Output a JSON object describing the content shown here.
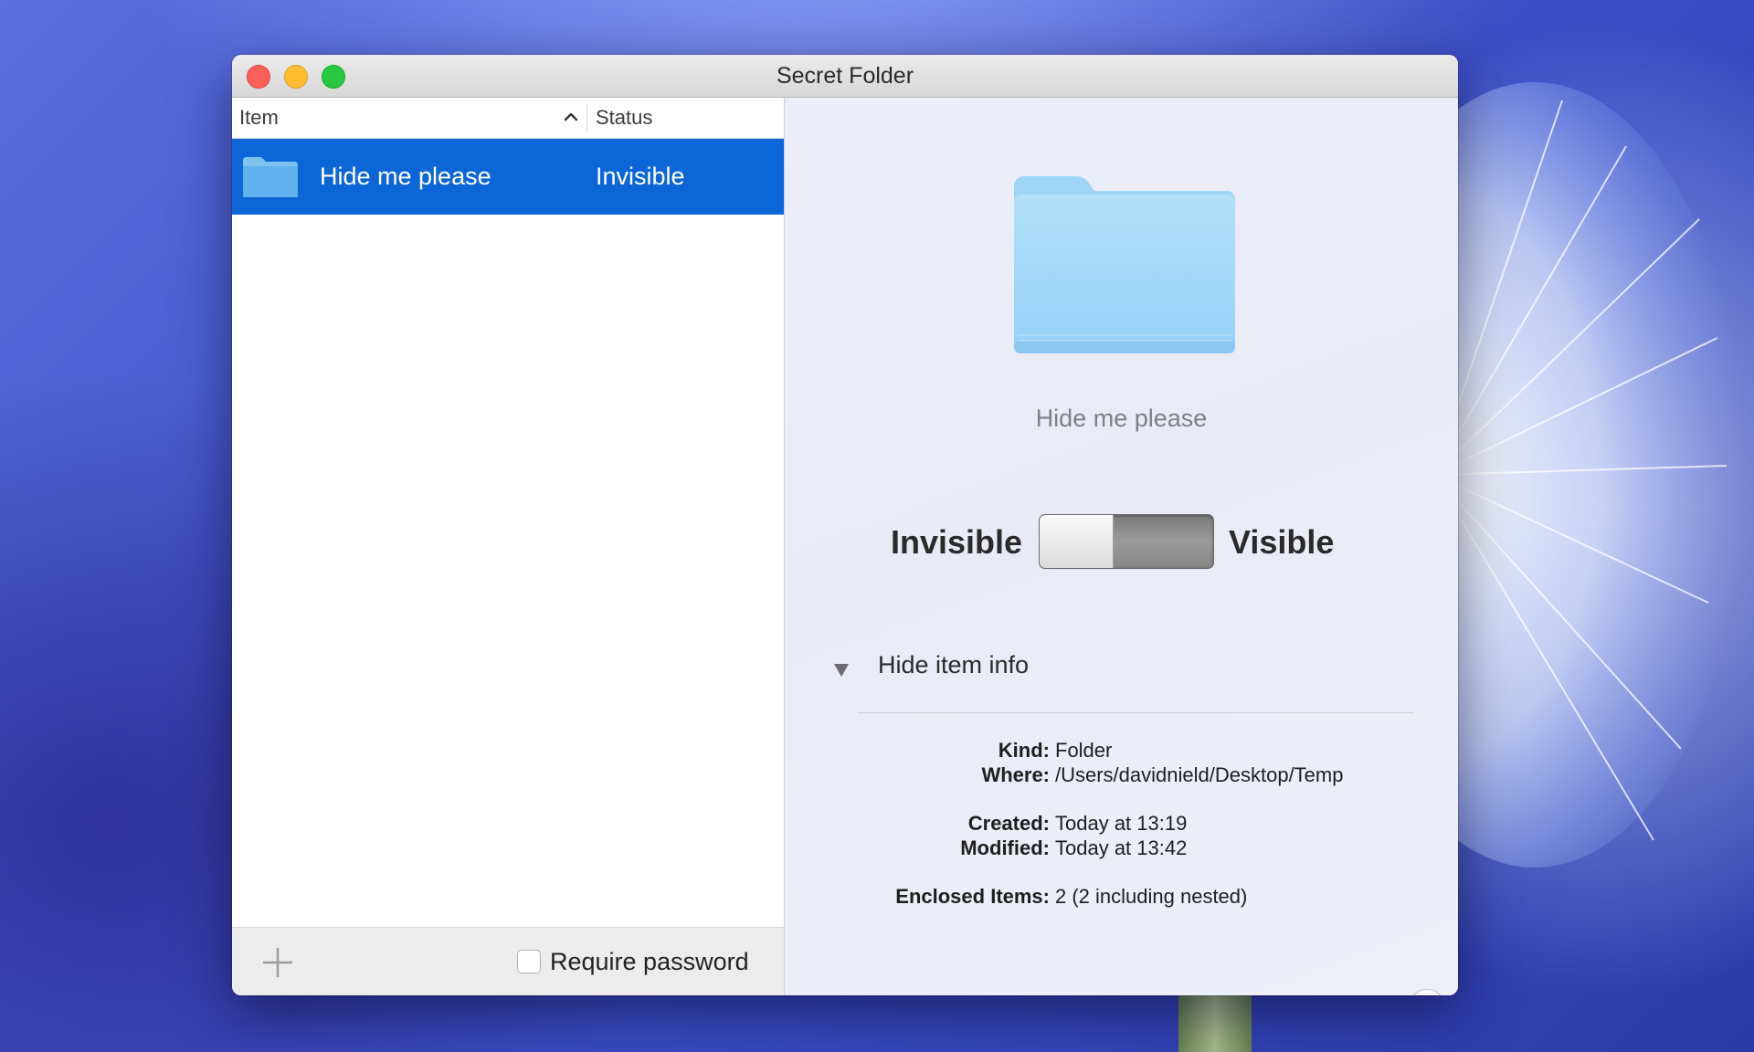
{
  "window": {
    "title": "Secret Folder"
  },
  "list": {
    "columns": {
      "item": "Item",
      "status": "Status"
    },
    "rows": [
      {
        "name": "Hide me please",
        "status": "Invisible"
      }
    ]
  },
  "footer": {
    "require_password_label": "Require password",
    "require_password_checked": false
  },
  "detail": {
    "item_name": "Hide me please",
    "toggle": {
      "left_label": "Invisible",
      "right_label": "Visible",
      "state": "Invisible"
    },
    "disclosure_label": "Hide item info",
    "info": {
      "kind_label": "Kind:",
      "kind_value": "Folder",
      "where_label": "Where:",
      "where_value": "/Users/davidnield/Desktop/Temp",
      "created_label": "Created:",
      "created_value": "Today at 13:19",
      "modified_label": "Modified:",
      "modified_value": "Today at 13:42",
      "enclosed_label": "Enclosed Items:",
      "enclosed_value": "2 (2 including nested)"
    },
    "help_label": "?"
  },
  "colors": {
    "selection": "#0d66d8",
    "folder": "#8fcff7",
    "accent": "#1a73e8"
  },
  "icons": {
    "folder": "folder-icon",
    "sort": "chevron-up-icon",
    "add": "plus-icon",
    "disclosure": "triangle-down-icon",
    "help": "help-icon"
  }
}
